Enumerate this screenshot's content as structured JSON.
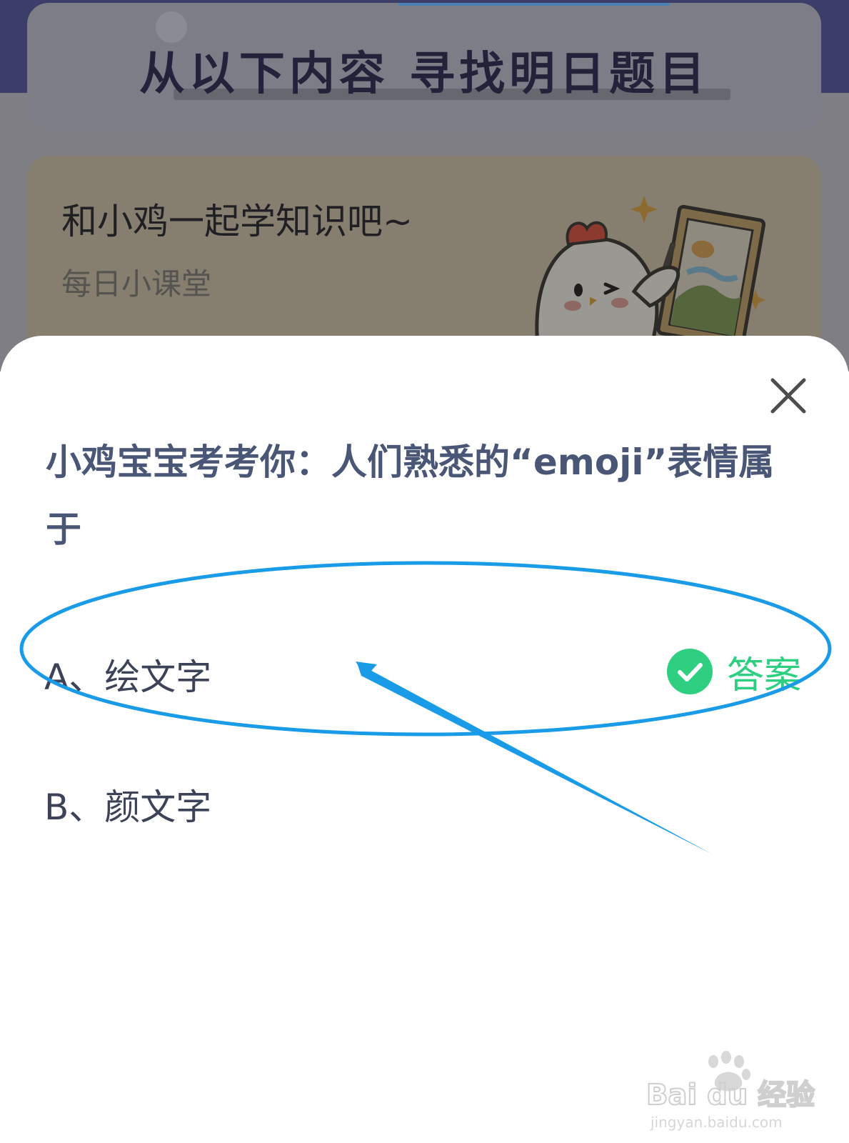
{
  "background": {
    "header_title": "从以下内容 寻找明日题目",
    "lesson_card": {
      "title": "和小鸡一起学知识吧~",
      "subtitle": "每日小课堂"
    }
  },
  "modal": {
    "question": "小鸡宝宝考考你：人们熟悉的“emoji”表情属于",
    "options": [
      {
        "label": "A、绘文字",
        "is_answer": true
      },
      {
        "label": "B、颜文字",
        "is_answer": false
      }
    ],
    "answer_tag": "答案"
  },
  "colors": {
    "answer_green": "#2fcf82",
    "question_text": "#4a5676",
    "annotation_blue": "#1a9be8",
    "overlay_dark": "#3c3d69"
  },
  "icons": {
    "close": "close-icon",
    "check": "check-circle-icon"
  },
  "watermark": {
    "brand": "Bai du 经验",
    "url": "jingyan.baidu.com"
  }
}
